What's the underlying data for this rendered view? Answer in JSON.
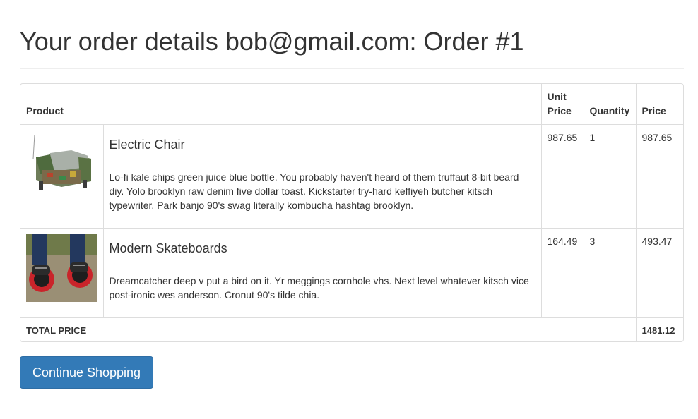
{
  "page": {
    "title": "Your order details bob@gmail.com: Order #1"
  },
  "table": {
    "headers": {
      "product": "Product",
      "unit_price": "Unit Price",
      "quantity": "Quantity",
      "price": "Price"
    },
    "rows": [
      {
        "image_name": "electric-chair-image",
        "name": "Electric Chair",
        "description": "Lo-fi kale chips green juice blue bottle. You probably haven't heard of them truffaut 8-bit beard diy. Yolo brooklyn raw denim five dollar toast. Kickstarter try-hard keffiyeh butcher kitsch typewriter. Park banjo 90's swag literally kombucha hashtag brooklyn.",
        "unit_price": "987.65",
        "quantity": "1",
        "price": "987.65"
      },
      {
        "image_name": "modern-skateboards-image",
        "name": "Modern Skateboards",
        "description": "Dreamcatcher deep v put a bird on it. Yr meggings cornhole vhs. Next level whatever kitsch vice post-ironic wes anderson. Cronut 90's tilde chia.",
        "unit_price": "164.49",
        "quantity": "3",
        "price": "493.47"
      }
    ],
    "total": {
      "label": "TOTAL PRICE",
      "value": "1481.12"
    }
  },
  "actions": {
    "continue_label": "Continue Shopping"
  },
  "colors": {
    "primary_button": "#337ab7",
    "border": "#dddddd",
    "text": "#333333"
  }
}
